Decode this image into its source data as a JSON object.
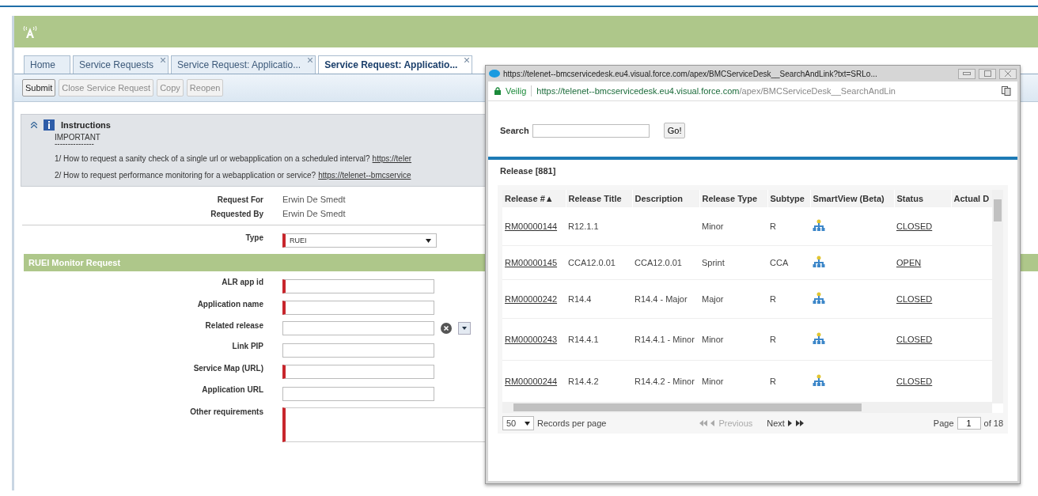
{
  "tabs": [
    {
      "label": "Home",
      "selected": false,
      "closable": false
    },
    {
      "label": "Service Requests",
      "selected": false,
      "closable": true
    },
    {
      "label": "Service Request: Applicatio...",
      "selected": false,
      "closable": true
    },
    {
      "label": "Service Request: Applicatio...",
      "selected": true,
      "closable": true
    }
  ],
  "toolbar": [
    {
      "label": "Submit",
      "disabled": false
    },
    {
      "label": "Close Service Request",
      "disabled": true
    },
    {
      "label": "Copy",
      "disabled": true
    },
    {
      "label": "Reopen",
      "disabled": true
    }
  ],
  "instructions": {
    "title": "Instructions",
    "heading": "IMPORTANT",
    "rule": "---------------",
    "lines": [
      {
        "text": "1/ How to request a sanity check of a single url or webapplication on a scheduled interval?",
        "link": "https://teler"
      },
      {
        "text": "2/ How to request performance monitoring for a webapplication or service?",
        "link": "https://telenet--bmcservice"
      }
    ]
  },
  "requester": [
    {
      "label": "Request For",
      "value": "Erwin De Smedt"
    },
    {
      "label": "Requested By",
      "value": "Erwin De Smedt"
    }
  ],
  "type_field": {
    "label": "Type",
    "value": "RUEI",
    "required": true
  },
  "section_title": "RUEI Monitor Request",
  "fields": [
    {
      "label": "ALR app id",
      "kind": "text",
      "required": true
    },
    {
      "label": "Application name",
      "kind": "text",
      "required": true
    },
    {
      "label": "Related release",
      "kind": "lookup",
      "required": false
    },
    {
      "label": "Link PIP",
      "kind": "text",
      "required": false
    },
    {
      "label": "Service Map (URL)",
      "kind": "text",
      "required": true
    },
    {
      "label": "Application URL",
      "kind": "text",
      "required": false
    },
    {
      "label": "Other requirements",
      "kind": "textarea",
      "required": true
    }
  ],
  "popup": {
    "title": "https://telenet--bmcservicedesk.eu4.visual.force.com/apex/BMCServiceDesk__SearchAndLink?txt=SRLo...",
    "secure_label": "Veilig",
    "url_host": "https://telenet--bmcservicedesk.eu4.visual.force.com",
    "url_path": "/apex/BMCServiceDesk__SearchAndLin",
    "search_label": "Search",
    "go_label": "Go!",
    "list_title": "Release [881]",
    "columns": [
      "Release #▲",
      "Release Title",
      "Description",
      "Release Type",
      "Subtype",
      "SmartView (Beta)",
      "Status",
      "Actual D"
    ],
    "rows": [
      {
        "id": "RM00000144",
        "title": "R12.1.1",
        "description": "",
        "type": "Minor",
        "subtype": "R",
        "status": "CLOSED"
      },
      {
        "id": "RM00000145",
        "title": "CCA12.0.01",
        "description": "CCA12.0.01",
        "type": "Sprint",
        "subtype": "CCA",
        "status": "OPEN"
      },
      {
        "id": "RM00000242",
        "title": "R14.4",
        "description": "R14.4 - Major",
        "type": "Major",
        "subtype": "R",
        "status": "CLOSED"
      },
      {
        "id": "RM00000243",
        "title": "R14.4.1",
        "description": "R14.4.1 - Minor",
        "type": "Minor",
        "subtype": "R",
        "status": "CLOSED"
      },
      {
        "id": "RM00000244",
        "title": "R14.4.2",
        "description": "R14.4.2 - Minor",
        "type": "Minor",
        "subtype": "R",
        "status": "CLOSED"
      }
    ],
    "page_size": "50",
    "records_label": "Records per page",
    "previous": "Previous",
    "previous_disabled": true,
    "next": "Next",
    "page_label": "Page",
    "page": "1",
    "page_total": "of 18"
  }
}
